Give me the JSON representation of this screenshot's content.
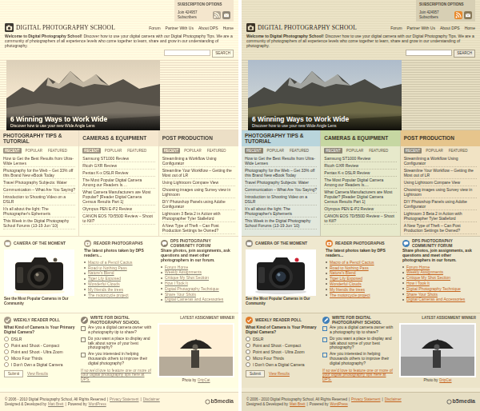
{
  "variants": [
    {
      "kind": "sepia"
    },
    {
      "kind": "color"
    }
  ],
  "subscription": {
    "label": "SUBSCRIPTION OPTIONS",
    "count": "Join 424957 Subscribers"
  },
  "logo": {
    "title": "DIGITAL PHOTOGRAPHY SCHOOL"
  },
  "nav": [
    "Forum",
    "Partner With Us",
    "About DPS",
    "Home"
  ],
  "welcome": {
    "lead": "Welcome to Digital Photography School!",
    "text": "Discover how to use your digital camera with our Digital Photography Tips. We are a community of photographers of all experience levels who come together to learn, share and grow in our understanding of photography."
  },
  "search": {
    "button": "SEARCH"
  },
  "hero": {
    "title": "6 Winning Ways to Work Wide",
    "subtitle": "Discover how to use your new Wide Angle Lens"
  },
  "columns": [
    {
      "title": "PHOTOGRAPHY TIPS & TUTORIAL",
      "color": "#b9d5dc",
      "tabs": [
        {
          "label": "RECENT",
          "selected": true
        },
        {
          "label": "POPULAR",
          "selected": false
        },
        {
          "label": "FEATURED",
          "selected": false
        }
      ],
      "items": [
        "How to Get the Best Results from Ultra-Wide Lenses",
        "Photography for the Web – Get 33% off this Brand New eBook Today",
        "Travel Photography Subjects: Water",
        "Communication – What Are You Saying?",
        "Introduction to Shooting Video on a DSLR",
        "It's all about the light: The Photographer's Ephemeris",
        "This Week in the Digital Photography School Forums (13-19 Jun '10)"
      ]
    },
    {
      "title": "CAMERAS & EQUIPMENT",
      "color": "#c6d7a2",
      "tabs": [
        {
          "label": "RECENT",
          "selected": true
        },
        {
          "label": "POPULAR",
          "selected": false
        },
        {
          "label": "FEATURED",
          "selected": false
        }
      ],
      "items": [
        "Samsung ST1000 Review",
        "Ricoh GXR Review",
        "Pentax K-x DSLR Review",
        "The Most Popular Digital Camera Among our Readers Is....",
        "What Camera Manufacturers are Most Popular? [Reader Digital Camera Census Results Part 1]",
        "Olympus PEN E-P2 Review",
        "CANON EOS 7D/550D Review – Shoot to Kill?"
      ]
    },
    {
      "title": "POST PRODUCTION",
      "color": "#e6c58c",
      "tabs": [
        {
          "label": "RECENT",
          "selected": true
        },
        {
          "label": "POPULAR",
          "selected": false
        },
        {
          "label": "FEATURED",
          "selected": false
        }
      ],
      "items": [
        "Streamlining a Workflow Using Configurator",
        "Streamline Your Workflow – Getting the Most out of LR",
        "Using Lightroom Compare View",
        "Choosing images using Survey view in Lightroom",
        "DIY Photoshop Panels using Adobe Configurator",
        "Lightroom 3 Beta 2 in Action with Photographer Tyler Stalleford",
        "A New Type of Theft – Can Post Production Settings be Owned?"
      ]
    }
  ],
  "camera": {
    "title": "CAMERA OF THE MOMENT",
    "caption": "See the Most Popular Cameras in Our Community"
  },
  "reader": {
    "title": "READER PHOTOGRAPHS",
    "intro": "The latest photos taken by DPS readers...",
    "links": [
      "Macro of a Pencil Cactus",
      "Road to Nothing Pass",
      "Nature's Blend",
      "Tiger Lily Exposed",
      "Wonderful Clouds",
      "My friends the trees",
      "The motorcycle project"
    ]
  },
  "forum": {
    "title": "DPS PHOTOGRAPHY COMMUNITY FORUM",
    "intro": "Share photos, join assignments, ask questions and meet other photographers in our forum.",
    "links": [
      "Forum Home",
      "Weekly Assignments",
      "Critique My Shot Section",
      "How I Took It",
      "Digital Photography Technique",
      "Share Your Shots",
      "Digital Cameras and Accessories"
    ]
  },
  "poll": {
    "title": "WEEKLY READER POLL",
    "question": "What Kind of Camera is Your Primary Digital Camera?",
    "options": [
      {
        "label": "DSLR",
        "selected": false
      },
      {
        "label": "Point and Shoot - Compact",
        "selected": false
      },
      {
        "label": "Point and Shoot - Ultra Zoom",
        "selected": false
      },
      {
        "label": "Micro Four Thirds",
        "selected": false
      },
      {
        "label": "I Don't Own a Digital Camera",
        "selected": false
      }
    ],
    "submit": "Submit",
    "results": "View Results"
  },
  "write": {
    "title": "WRITE FOR DIGITAL PHOTOGRAPHY SCHOOL",
    "bullets": [
      "Are you a digital camera owner with a photography tip to share?",
      "Do you want a place to display and talk about some of your best photography?",
      "Are you interested in helping thousands others to improve their digital photography?"
    ],
    "note": "If so we'd love to feature one or more of your digital photography tips here at DPS."
  },
  "winner": {
    "title": "LATEST ASSIGNMENT WINNER",
    "prefix": "Photo by",
    "author": "DripCat"
  },
  "footer": {
    "lines": [
      [
        {
          "text": "© 2006 - 2010 Digital Photography School, All Rights Reserved",
          "link": false
        },
        {
          "text": "|",
          "link": false
        },
        {
          "text": "Privacy Statement",
          "link": true
        },
        {
          "text": "|",
          "link": false
        },
        {
          "text": "Disclaimer",
          "link": true
        }
      ],
      [
        {
          "text": "Designed & Developed by",
          "link": false
        },
        {
          "text": "Matt Brett",
          "link": true
        },
        {
          "text": "|",
          "link": false
        },
        {
          "text": "Powered by",
          "link": false
        },
        {
          "text": "WordPress",
          "link": true
        }
      ]
    ],
    "brand": "b5media"
  }
}
